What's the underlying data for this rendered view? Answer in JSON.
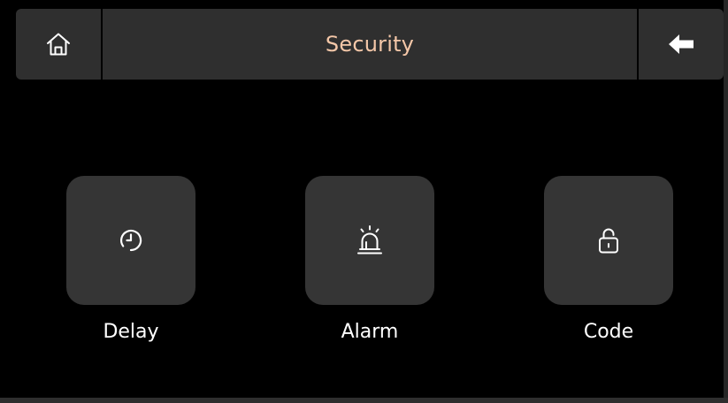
{
  "header": {
    "title": "Security",
    "home_icon": "home-icon",
    "back_icon": "arrow-left-icon"
  },
  "tiles": [
    {
      "label": "Delay",
      "icon": "clock-icon"
    },
    {
      "label": "Alarm",
      "icon": "siren-icon"
    },
    {
      "label": "Code",
      "icon": "unlock-icon"
    }
  ],
  "colors": {
    "background": "#000000",
    "header_bg": "#2f2f2f",
    "tile_bg": "#353535",
    "title_accent": "#f4c7a8",
    "icon": "#ffffff",
    "label": "#ffffff"
  }
}
